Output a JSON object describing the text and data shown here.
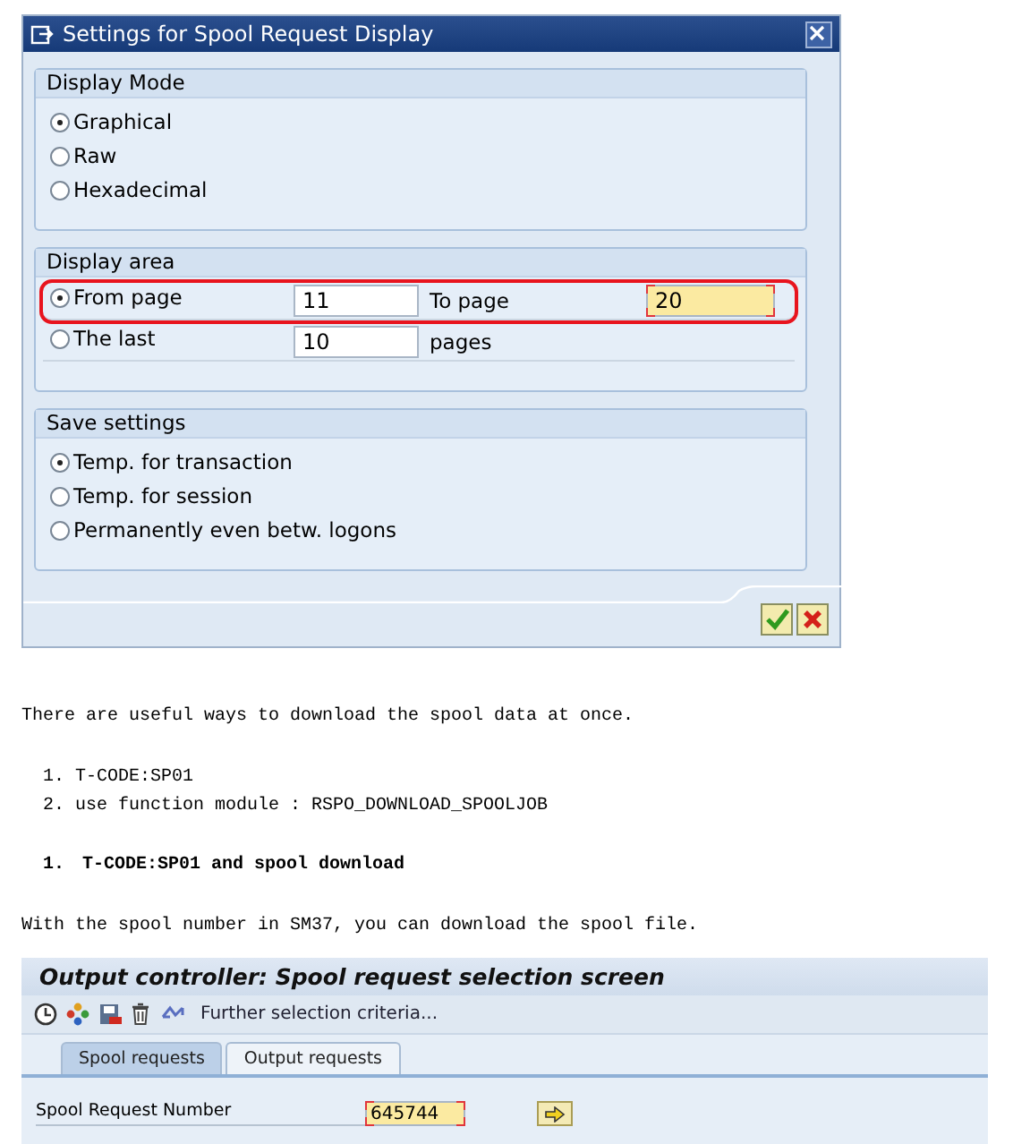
{
  "dialog": {
    "title": "Settings for Spool Request Display",
    "groups": [
      {
        "title": "Display Mode",
        "kind": "radios",
        "options": [
          {
            "label": "Graphical",
            "selected": true
          },
          {
            "label": "Raw",
            "selected": false
          },
          {
            "label": "Hexadecimal",
            "selected": false
          }
        ]
      },
      {
        "title": "Display area",
        "kind": "range",
        "rows": [
          {
            "label": "From page",
            "selected": true,
            "highlighted": true,
            "value": "11",
            "after": "To page",
            "field_2": {
              "value": "20",
              "focused": true
            }
          },
          {
            "label": "The last",
            "selected": false,
            "highlighted": false,
            "value": "10",
            "after": "pages"
          }
        ]
      },
      {
        "title": "Save settings",
        "kind": "radios",
        "options": [
          {
            "label": "Temp. for transaction",
            "selected": true
          },
          {
            "label": "Temp. for session",
            "selected": false
          },
          {
            "label": "Permanently even betw. logons",
            "selected": false
          }
        ]
      }
    ],
    "buttons": [
      {
        "kind": "confirm"
      },
      {
        "kind": "cancel"
      }
    ]
  },
  "article": {
    "intro": "There are useful ways to download the spool data at once.",
    "list": [
      {
        "number": "1.",
        "text": "T-CODE:SP01"
      },
      {
        "number": "2.",
        "text": "use function module : RSPO_DOWNLOAD_SPOOLJOB"
      }
    ],
    "heading": {
      "number": "1.",
      "text": "T-CODE:SP01 and spool download"
    },
    "paragraph": "With the spool number in SM37, you can download the spool file."
  },
  "screen": {
    "title": "Output controller: Spool request selection screen",
    "toolbar": {
      "icons": [
        {
          "kind": "clock"
        },
        {
          "kind": "dots"
        },
        {
          "kind": "disk"
        },
        {
          "kind": "trash"
        },
        {
          "kind": "loop"
        }
      ],
      "link": "Further selection criteria..."
    },
    "tabs": [
      {
        "label": "Spool requests",
        "selected": true
      },
      {
        "label": "Output requests",
        "selected": false
      }
    ],
    "field": {
      "label": "Spool Request Number",
      "value": "645744",
      "focused": true
    }
  }
}
